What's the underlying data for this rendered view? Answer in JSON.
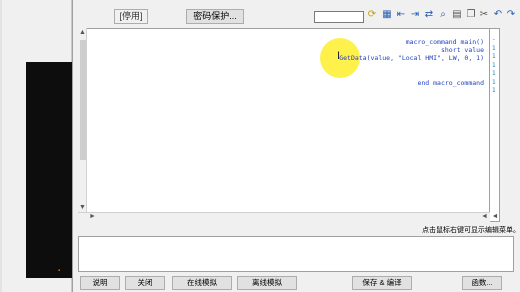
{
  "toolbar": {
    "disabled_label": "[停用]",
    "lock_label": "密码保护...",
    "search_value": ""
  },
  "icons": [
    "rollback-icon",
    "undo-icon",
    "cut-icon",
    "copy-icon",
    "paste-icon",
    "find-icon",
    "replace-icon",
    "indent-icon",
    "outdent-icon",
    "bookmark-icon",
    "find-next-icon"
  ],
  "editor": {
    "code": "macro_command main()\nshort value\nGetData(value, \"Local HMI\", LW, 0, 1)\n\n\nend macro_command",
    "gutter": "-\n1\n1\n1\n1\n1\n1"
  },
  "hint": "点击鼠标右键可显示编辑菜单。",
  "buttons": {
    "help": "说明",
    "close": "关闭",
    "check": "在线模拟",
    "check_all": "离线模拟",
    "save": "保存 & 编译",
    "ok": "函数..."
  },
  "colors": {
    "code": "#1f3fbf",
    "highlight": "#ffef33",
    "dialog_bg": "#f0f0f0"
  }
}
